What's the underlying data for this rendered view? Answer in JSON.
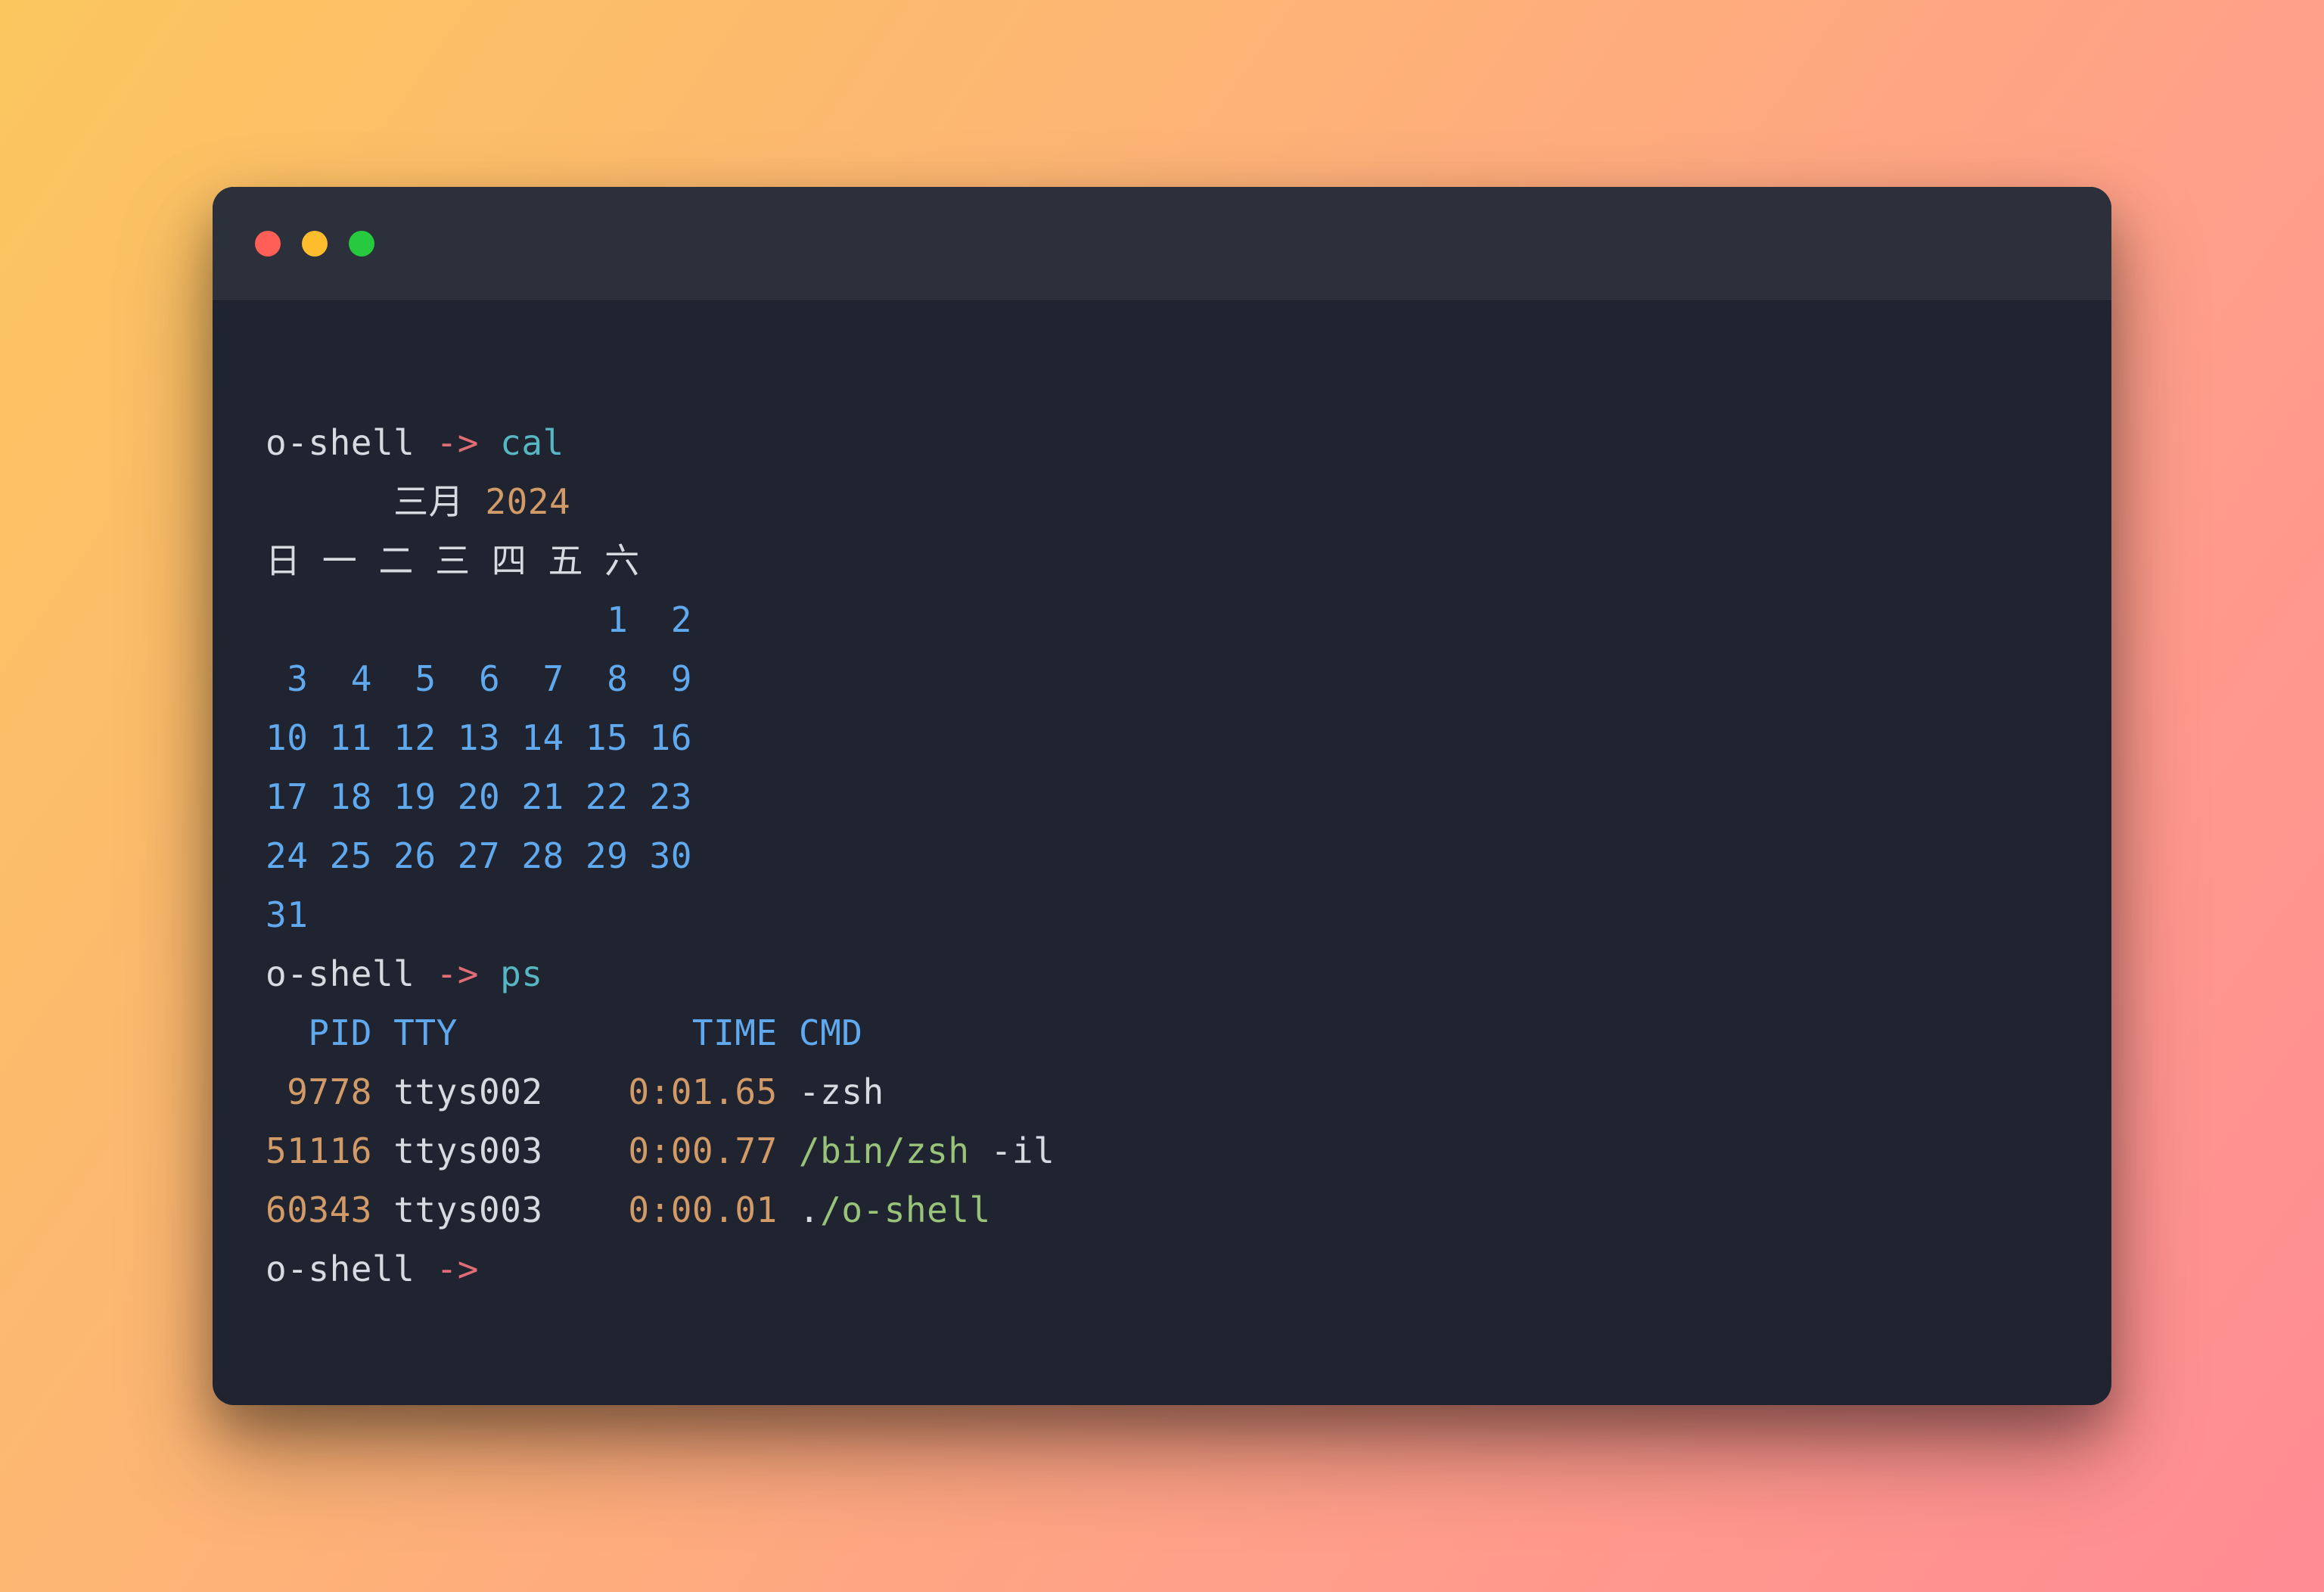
{
  "colors": {
    "bg_window": "#1f2430",
    "bg_titlebar": "#2b303b",
    "text_default": "#d7dae0",
    "red": "#e06c75",
    "teal": "#56b6c2",
    "orange": "#d19a66",
    "blue": "#60a9ef",
    "green": "#98c379"
  },
  "traffic_lights": [
    "close",
    "minimize",
    "zoom"
  ],
  "prompt": {
    "name": "o-shell",
    "arrow": " -> "
  },
  "cmd1": "cal",
  "cmd2": "ps",
  "cal": {
    "header_pad": "      ",
    "month": "三月",
    "space": " ",
    "year": "2024",
    "weekdays": "日 一 二 三 四 五 六",
    "row1": "                1  2",
    "row2": " 3  4  5  6  7  8  9",
    "row3": "10 11 12 13 14 15 16",
    "row4": "17 18 19 20 21 22 23",
    "row5": "24 25 26 27 28 29 30",
    "row6": "31"
  },
  "ps": {
    "hdr_pid": "  PID",
    "hdr_tty": " TTY",
    "hdr_pad": "           ",
    "hdr_time": "TIME",
    "hdr_space": " ",
    "hdr_cmd": "CMD",
    "r1_pid": " 9778",
    "r1_sp1": " ",
    "r1_tty": "ttys002",
    "r1_pad": "    ",
    "r1_time": "0:01.65",
    "r1_sp2": " ",
    "r1_cmd": "-zsh",
    "r2_pid": "51116",
    "r2_sp1": " ",
    "r2_tty": "ttys003",
    "r2_pad": "    ",
    "r2_time": "0:00.77",
    "r2_sp2": " ",
    "r2_cmd_path": "/bin/zsh",
    "r2_cmd_args": " -il",
    "r3_pid": "60343",
    "r3_sp1": " ",
    "r3_tty": "ttys003",
    "r3_pad": "    ",
    "r3_time": "0:00.01",
    "r3_sp2": " ",
    "r3_cmd_dot": ".",
    "r3_cmd_rest": "/o-shell"
  }
}
